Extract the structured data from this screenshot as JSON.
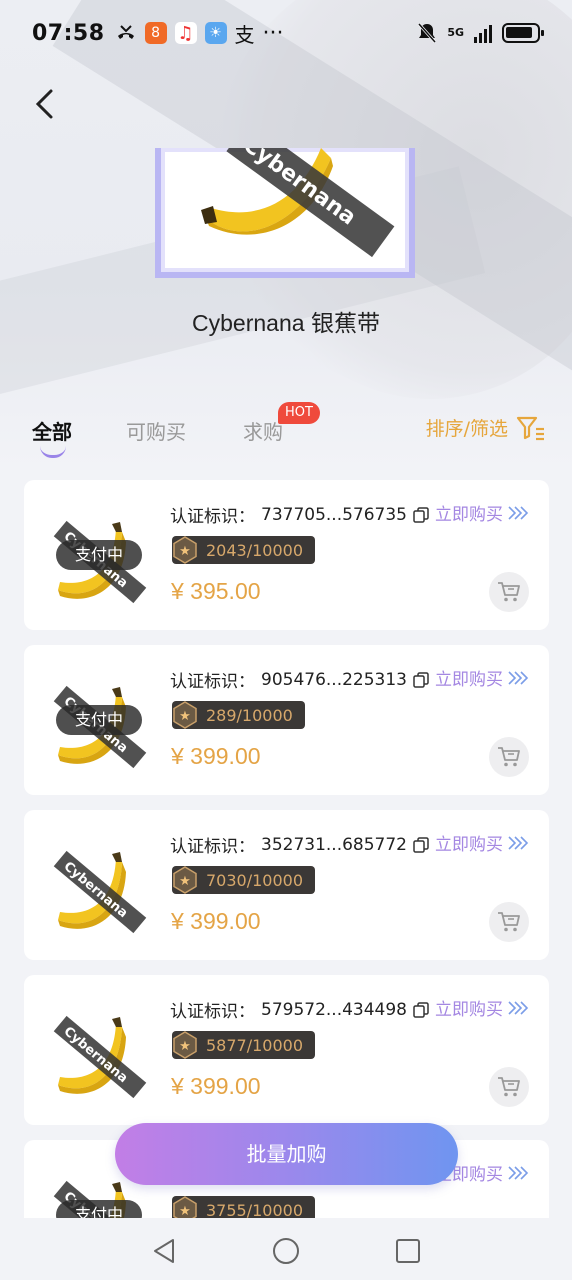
{
  "status_bar": {
    "time": "07:58",
    "ellipsis": "···",
    "network": "5G"
  },
  "product": {
    "title": "Cybernana 银蕉带",
    "tape_text": "Cybernana"
  },
  "tabs": [
    {
      "label": "全部",
      "active": true
    },
    {
      "label": "可购买",
      "active": false
    },
    {
      "label": "求购",
      "active": false
    }
  ],
  "hot_badge": "HOT",
  "sort_filter": "排序/筛选",
  "cert_label": "认证标识：",
  "buy_now_label": "立即购买",
  "batch_button": "批量加购",
  "items": [
    {
      "cert_id": "737705...576735",
      "edition": "2043/10000",
      "price": "¥ 395.00",
      "status": "支付中"
    },
    {
      "cert_id": "905476...225313",
      "edition": "289/10000",
      "price": "¥ 399.00",
      "status": "支付中"
    },
    {
      "cert_id": "352731...685772",
      "edition": "7030/10000",
      "price": "¥ 399.00",
      "status": ""
    },
    {
      "cert_id": "579572...434498",
      "edition": "5877/10000",
      "price": "¥ 399.00",
      "status": ""
    },
    {
      "cert_id": "",
      "edition": "3755/10000",
      "price": "",
      "status": "支付中"
    }
  ],
  "colors": {
    "accent_purple": "#a487e2",
    "price_gold": "#e4a446",
    "hot_red": "#ef4a3c",
    "filter_orange": "#e6a63c"
  }
}
